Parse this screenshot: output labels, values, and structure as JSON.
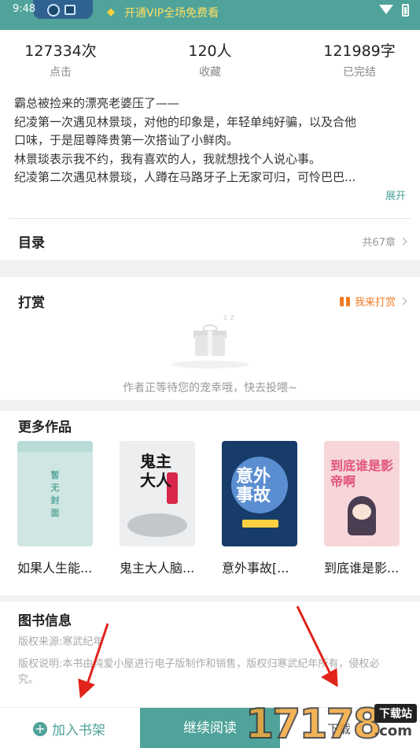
{
  "status_bar": {
    "time": "9:48",
    "vip_text": "开通VIP全场免费看"
  },
  "stats": [
    {
      "value": "127334次",
      "label": "点击"
    },
    {
      "value": "120人",
      "label": "收藏"
    },
    {
      "value": "121989字",
      "label": "已完结"
    }
  ],
  "synopsis": [
    "霸总被捡来的漂亮老婆压了——",
    "纪凌第一次遇见林景琰，对他的印象是，年轻单纯好骗，以及合他",
    "口味，于是屈尊降贵第一次搭讪了小鲜肉。",
    "林景琰表示我不约，我有喜欢的人，我就想找个人说心事。",
    "纪凌第二次遇见林景琰，人蹲在马路牙子上无家可归，可怜巴巴..."
  ],
  "expand_label": "展开",
  "catalog": {
    "title": "目录",
    "count": "共67章"
  },
  "reward": {
    "title": "打赏",
    "button": "我来打赏",
    "empty_caption": "作者正等待您的宠幸哦，快去投喂~",
    "zz": "z z"
  },
  "more_works": {
    "title": "更多作品",
    "books": [
      {
        "title": "如果人生能...",
        "cover_text": "暂无封面"
      },
      {
        "title": "鬼主大人脑...",
        "cover_text": "鬼主大人"
      },
      {
        "title": "意外事故[...",
        "cover_text": "意外事故"
      },
      {
        "title": "到底谁是影...",
        "cover_text": "到底谁是影帝啊"
      }
    ]
  },
  "book_info": {
    "title": "图书信息",
    "source": "版权来源:寒武纪年",
    "statement_line1": "版权说明:本书由纯爱小屋进行电子版制作和销售，版权归寒武纪年所有，侵权必",
    "statement_line2": "究。"
  },
  "bottom_bar": {
    "add_shelf": "加入书架",
    "continue": "继续阅读",
    "third": "下载"
  },
  "watermark": {
    "digits": "17178",
    "site": "下载站",
    "com": ".com"
  },
  "colors": {
    "accent": "#4fa39a",
    "reward": "#f07b23",
    "arrow": "#e0241b"
  }
}
